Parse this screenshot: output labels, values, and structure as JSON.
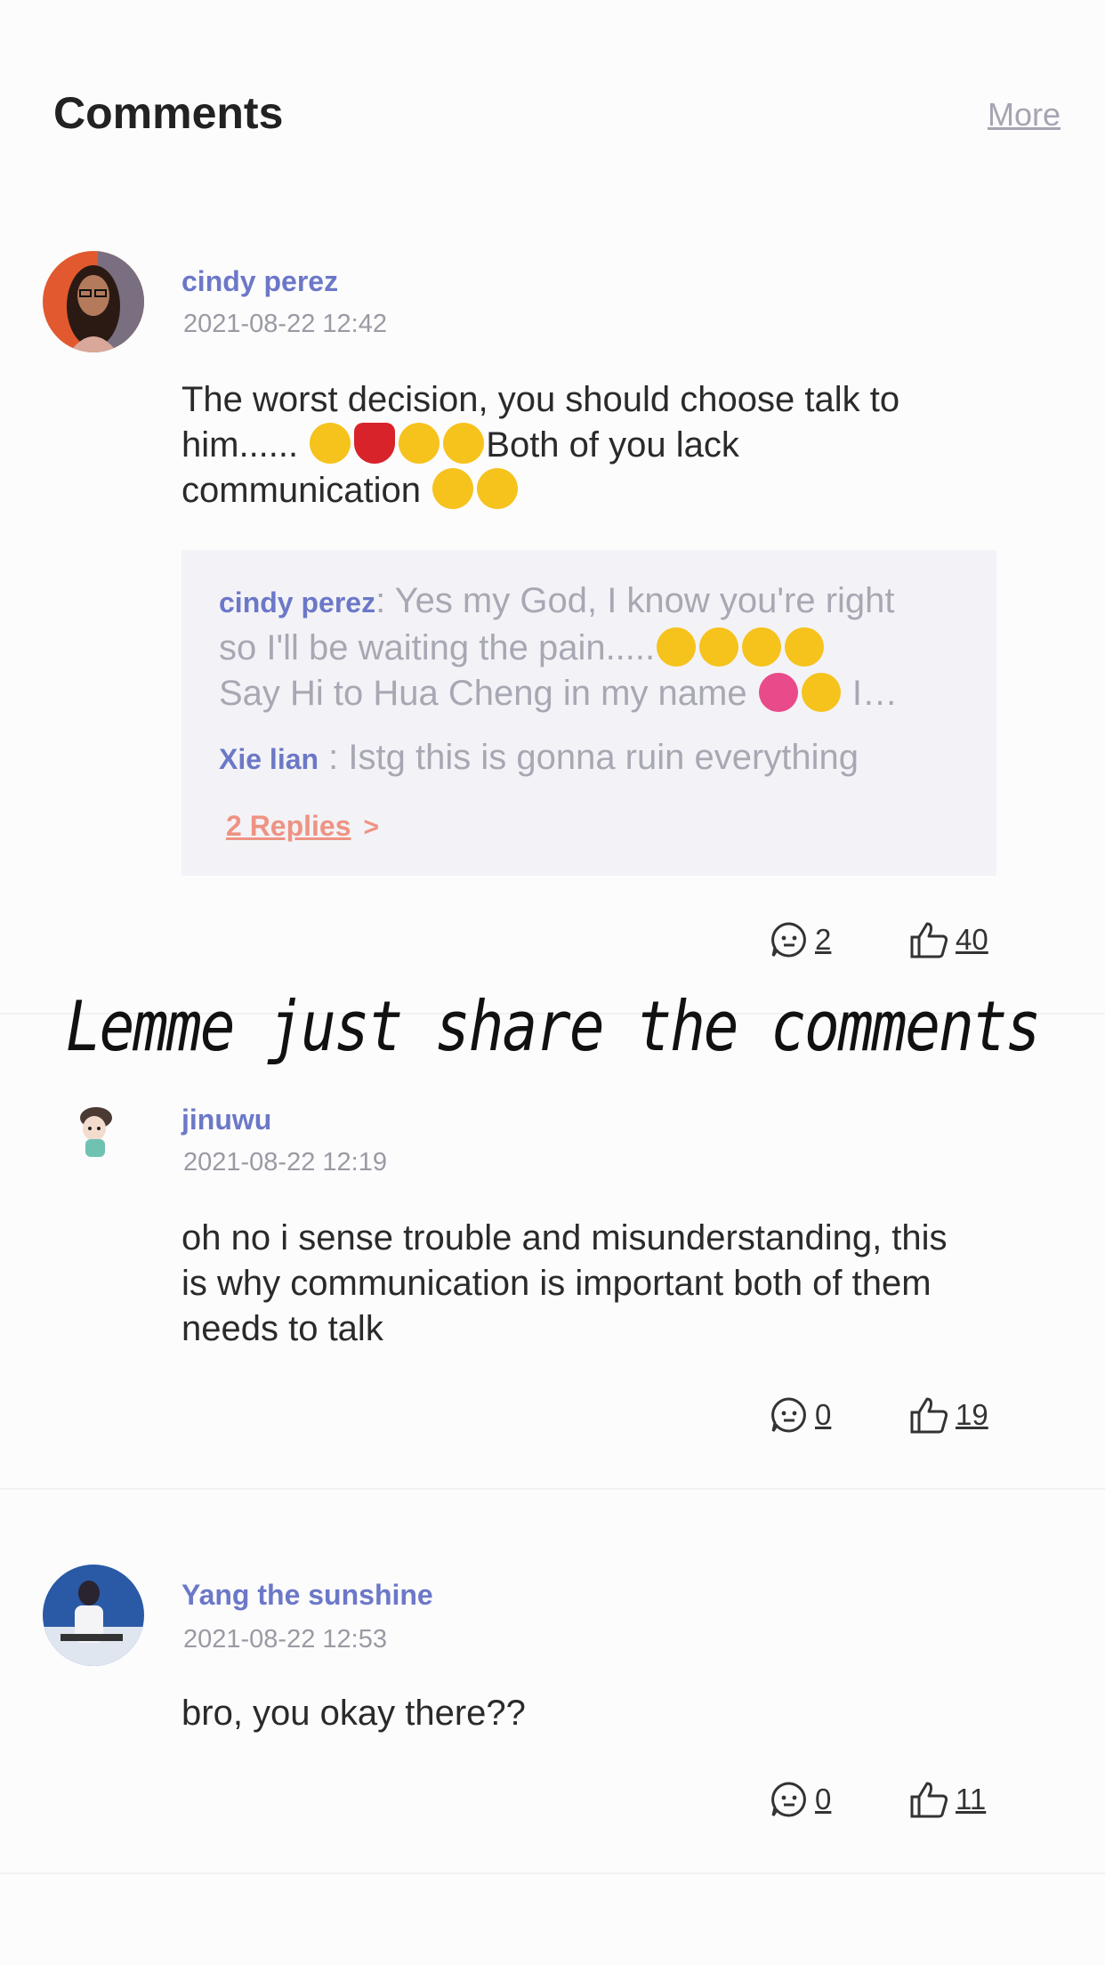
{
  "header": {
    "title": "Comments",
    "more_label": "More"
  },
  "overlay_caption": "Lemme just share the comments",
  "comments": [
    {
      "username": "cindy perez",
      "timestamp": "2021-08-22 12:42",
      "text_line1": "The worst decision, you should choose talk to",
      "text_line2_a": "him......",
      "text_line2_b": "Both of you lack",
      "text_line3": "communication",
      "reply_count": "2",
      "like_count": "40",
      "replies": [
        {
          "name": "cindy perez",
          "text_line1": ": Yes my God, I know you're right",
          "text_line2": "so I'll be waiting the pain.....",
          "text_line3": "Say Hi to Hua Cheng in my name",
          "text_line3_tail": "I…"
        },
        {
          "name": "Xie lian",
          "text": " : Istg this is gonna ruin everything"
        }
      ],
      "replies_link": "2 Replies"
    },
    {
      "username": "jinuwu",
      "timestamp": "2021-08-22 12:19",
      "text_line1": "oh no i sense trouble and misunderstanding, this",
      "text_line2": "is why communication is important both of them",
      "text_line3": "needs to talk",
      "reply_count": "0",
      "like_count": "19"
    },
    {
      "username": "Yang the sunshine",
      "timestamp": "2021-08-22 12:53",
      "text_line1": "bro, you okay there??",
      "reply_count": "0",
      "like_count": "11"
    }
  ],
  "icons": {
    "reply": "comment-bubble-icon",
    "like": "thumbs-up-icon"
  },
  "colors": {
    "username": "#6c78c7",
    "replies_link": "#ee9383",
    "timestamp": "#9a9aa4"
  }
}
